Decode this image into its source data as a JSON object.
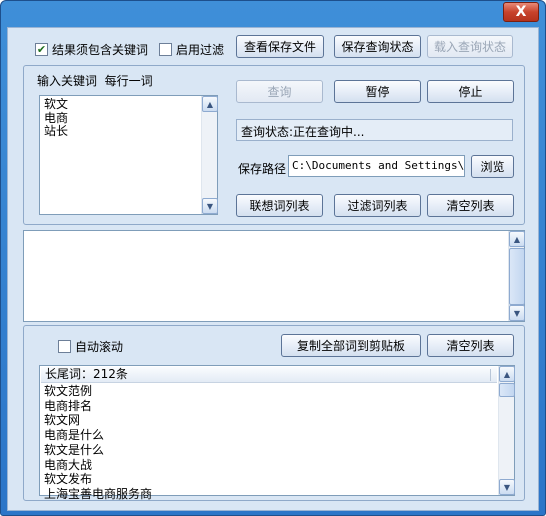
{
  "window": {
    "close_label": "X"
  },
  "options": {
    "must_contain_keyword": {
      "label": "结果须包含关键词",
      "checked": true
    },
    "enable_filter": {
      "label": "启用过滤",
      "checked": false
    }
  },
  "toolbar": {
    "view_saved_file": "查看保存文件",
    "save_query_state": "保存查询状态",
    "load_query_state": "载入查询状态"
  },
  "keywords": {
    "header_label": "输入关键词",
    "hint_label": "每行一词",
    "items": [
      "软文",
      "电商",
      "站长"
    ]
  },
  "controls": {
    "query": "查询",
    "pause": "暂停",
    "stop": "停止",
    "status_text": "查询状态:正在查询中...",
    "save_path_label": "保存路径",
    "save_path_value": "C:\\Documents and Settings\\Adm",
    "browse": "浏览",
    "suggest_list": "联想词列表",
    "filter_list": "过滤词列表",
    "clear_list": "清空列表"
  },
  "lower": {
    "auto_scroll": {
      "label": "自动滚动",
      "checked": false
    },
    "copy_all": "复制全部词到剪贴板",
    "clear_list": "清空列表",
    "list_header": "长尾词：212条",
    "results": [
      "软文范例",
      "电商排名",
      "软文网",
      "电商是什么",
      "软文是什么",
      "电商大战",
      "软文发布",
      "上海宝善电商服务商"
    ]
  },
  "colors": {
    "titlebar": "#2b75c8",
    "client_bg": "#d9e6f4",
    "close_button": "#c8432c"
  }
}
